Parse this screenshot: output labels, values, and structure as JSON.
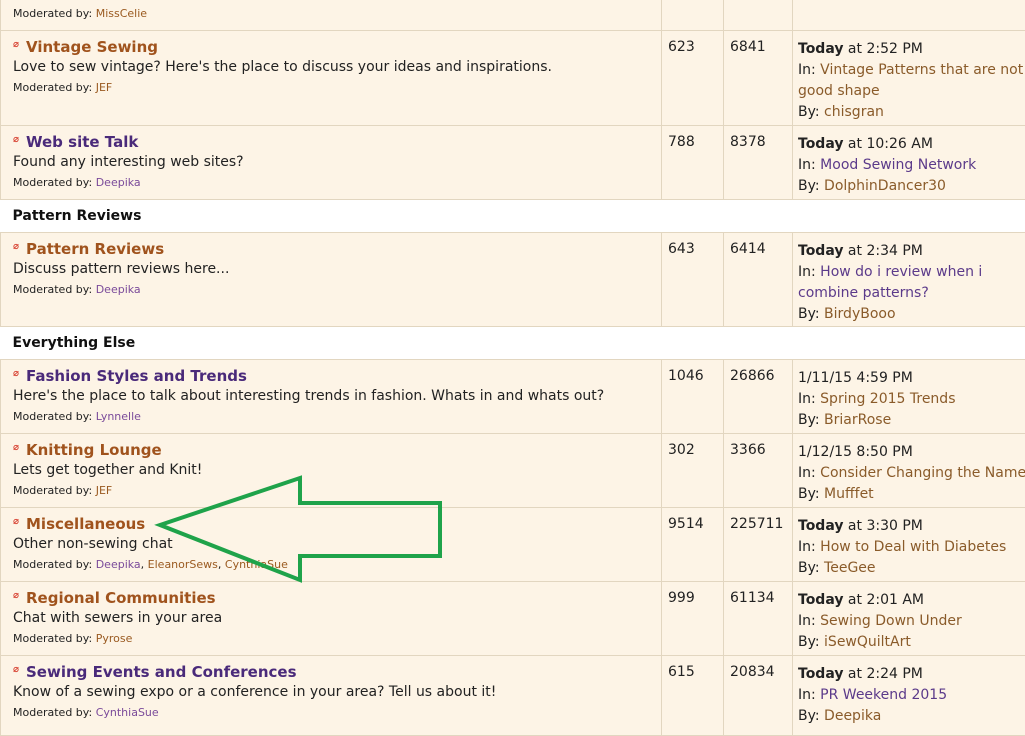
{
  "top_row": {
    "mod_label": "Moderated by:",
    "mods": [
      "MissCelie"
    ]
  },
  "boards_a": [
    {
      "title": "Vintage Sewing",
      "desc": "Love to sew vintage? Here's the place to discuss your ideas and inspirations.",
      "mod_label": "Moderated by:",
      "mods": [
        "JEF"
      ],
      "topics": "623",
      "posts": "6841",
      "last_when_bold": "Today",
      "last_when": " at 2:52 PM",
      "last_in_label": "In: ",
      "last_in": "Vintage Patterns that are not in good shape",
      "last_by_label": "By: ",
      "last_by": "chisgran"
    },
    {
      "title": "Web site Talk",
      "desc": "Found any interesting web sites?",
      "mod_label": "Moderated by:",
      "mods": [
        "Deepika"
      ],
      "topics": "788",
      "posts": "8378",
      "last_when_bold": "Today",
      "last_when": " at 10:26 AM",
      "last_in_label": "In: ",
      "last_in": "Mood Sewing Network",
      "last_by_label": "By: ",
      "last_by": "DolphinDancer30"
    }
  ],
  "cat_pattern": "Pattern Reviews",
  "boards_b": [
    {
      "title": "Pattern Reviews",
      "desc": "Discuss pattern reviews here...",
      "mod_label": "Moderated by:",
      "mods": [
        "Deepika"
      ],
      "topics": "643",
      "posts": "6414",
      "last_when_bold": "Today",
      "last_when": " at 2:34 PM",
      "last_in_label": "In: ",
      "last_in": "How do i review when i combine patterns?",
      "last_by_label": "By: ",
      "last_by": "BirdyBooo"
    }
  ],
  "cat_else": "Everything Else",
  "boards_c": [
    {
      "title": "Fashion Styles and Trends",
      "desc": "Here's the place to talk about interesting trends in fashion. Whats in and whats out?",
      "mod_label": "Moderated by:",
      "mods": [
        "Lynnelle"
      ],
      "topics": "1046",
      "posts": "26866",
      "last_when_bold": "",
      "last_when": "1/11/15 4:59 PM",
      "last_in_label": "In: ",
      "last_in": "Spring 2015 Trends",
      "last_by_label": "By: ",
      "last_by": "BriarRose"
    },
    {
      "title": "Knitting Lounge",
      "desc": "Lets get together and Knit!",
      "mod_label": "Moderated by:",
      "mods": [
        "JEF"
      ],
      "topics": "302",
      "posts": "3366",
      "last_when_bold": "",
      "last_when": "1/12/15 8:50 PM",
      "last_in_label": "In: ",
      "last_in": "Consider Changing the Name",
      "last_by_label": "By: ",
      "last_by": "Mufffet"
    },
    {
      "title": "Miscellaneous",
      "desc": "Other non-sewing chat",
      "mod_label": "Moderated by:",
      "mods": [
        "Deepika",
        "EleanorSews",
        "CynthiaSue"
      ],
      "topics": "9514",
      "posts": "225711",
      "last_when_bold": "Today",
      "last_when": " at 3:30 PM",
      "last_in_label": "In: ",
      "last_in": "How to Deal with Diabetes",
      "last_by_label": "By: ",
      "last_by": "TeeGee"
    },
    {
      "title": "Regional Communities",
      "desc": "Chat with sewers in your area",
      "mod_label": "Moderated by:",
      "mods": [
        "Pyrose"
      ],
      "topics": "999",
      "posts": "61134",
      "last_when_bold": "Today",
      "last_when": " at 2:01 AM",
      "last_in_label": "In: ",
      "last_in": "Sewing Down Under",
      "last_by_label": "By: ",
      "last_by": "iSewQuiltArt"
    },
    {
      "title": "Sewing Events and Conferences",
      "desc": "Know of a sewing expo or a conference in your area? Tell us about it!",
      "mod_label": "Moderated by:",
      "mods": [
        "CynthiaSue"
      ],
      "topics": "615",
      "posts": "20834",
      "last_when_bold": "Today",
      "last_when": " at 2:24 PM",
      "last_in_label": "In: ",
      "last_in": "PR Weekend 2015",
      "last_by_label": "By: ",
      "last_by": "Deepika"
    }
  ],
  "colors": {
    "row_bg": "#fdf4e6",
    "board_link": "#a0531d",
    "visited_link": "#4a2a7a",
    "annotation_arrow": "#1fa34a"
  },
  "icons": {
    "board_status": "new-posts-icon"
  }
}
